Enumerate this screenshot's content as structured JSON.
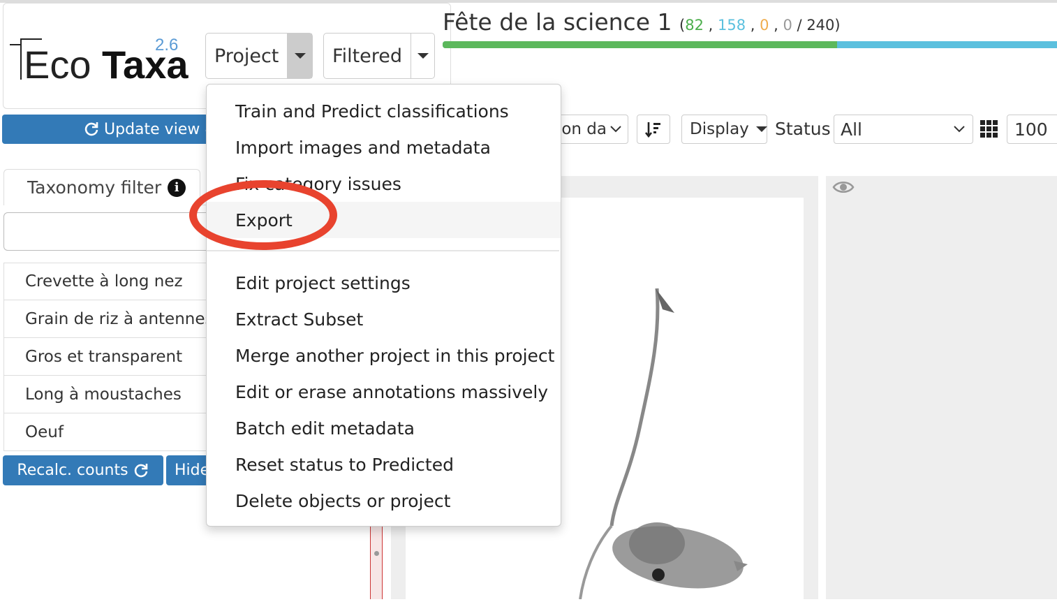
{
  "app": {
    "logo_text": "EcoTaxa",
    "version": "2.6"
  },
  "header": {
    "project_menu_label": "Project",
    "filtered_label": "Filtered",
    "project_title": "Fête de la science 1",
    "counts": {
      "validated": "82",
      "predicted": "158",
      "dubious": "0",
      "unclassified": "0",
      "total": "240"
    },
    "progress_validated_fraction": 0.6417,
    "colors": {
      "validated": "#5cb85c",
      "predicted": "#5bc0de",
      "dubious": "#f0ad4e"
    }
  },
  "toolbar": {
    "update_view_label": "Update view &",
    "sort_field_text": "on da",
    "display_label": "Display",
    "status_label": "Status",
    "status_value": "All",
    "page_size_value": "100"
  },
  "left_panel": {
    "taxonomy_tab_label": "Taxonomy filter",
    "taxa": [
      "Crevette à long nez",
      "Grain de riz à antennes",
      "Gros et transparent",
      "Long à moustaches",
      "Oeuf"
    ],
    "recalc_label": "Recalc. counts",
    "hide_label": "Hide"
  },
  "project_menu": {
    "items_top": [
      "Train and Predict classifications",
      "Import images and metadata",
      "Fix category issues",
      "Export"
    ],
    "items_bottom": [
      "Edit project settings",
      "Extract Subset",
      "Merge another project in this project",
      "Edit or erase annotations massively",
      "Batch edit metadata",
      "Reset status to Predicted",
      "Delete objects or project"
    ],
    "highlighted_item": "Export"
  }
}
